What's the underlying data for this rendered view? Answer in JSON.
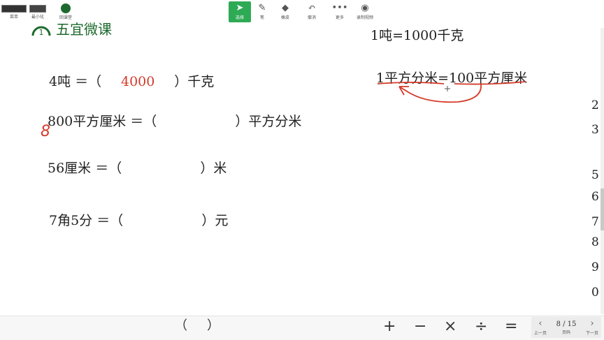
{
  "brand": {
    "logo_digit": "1",
    "title": "五宜微课"
  },
  "reference": {
    "line1": "1吨=1000千克",
    "line2": "1平方分米=100平方厘米"
  },
  "questions": [
    {
      "left": "4吨 ＝（",
      "answer": "4000",
      "right": "）千克"
    },
    {
      "left": "800平方厘米 ＝（",
      "answer": "",
      "right": "）平方分米"
    },
    {
      "left": "56厘米 ＝（",
      "answer": "",
      "right": "）米"
    },
    {
      "left": "7角5分 ＝（",
      "answer": "",
      "right": "）元"
    }
  ],
  "handwritten_digit": "8",
  "right_numbers": [
    "2",
    "3",
    "5",
    "6",
    "7",
    "8",
    "9",
    "0"
  ],
  "toolbar": {
    "left_buttons": [
      {
        "label": "菜单",
        "icon": "menu-icon"
      },
      {
        "label": "最小化",
        "icon": "minimize-icon"
      },
      {
        "label": "回课堂",
        "icon": "classroom-icon"
      }
    ],
    "parens": [
      "（",
      "）"
    ],
    "tools": [
      {
        "label": "选择",
        "icon": "cursor-icon",
        "active": true
      },
      {
        "label": "笔",
        "icon": "pen-icon",
        "active": false
      },
      {
        "label": "橡皮",
        "icon": "eraser-icon",
        "active": false
      },
      {
        "label": "撤消",
        "icon": "undo-icon",
        "active": false
      },
      {
        "label": "更多",
        "icon": "more-icon",
        "active": false
      },
      {
        "label": "录制视频",
        "icon": "record-icon",
        "active": false
      }
    ],
    "operators": [
      "+",
      "−",
      "×",
      "÷",
      "="
    ],
    "pager": {
      "prev_label": "上一页",
      "page_label": "页码",
      "page": "8 / 15",
      "next_label": "下一页"
    }
  },
  "colors": {
    "brand_green": "#1e6a2e",
    "annotation_red": "#d43a2a",
    "active_tool": "#2eaa55"
  }
}
